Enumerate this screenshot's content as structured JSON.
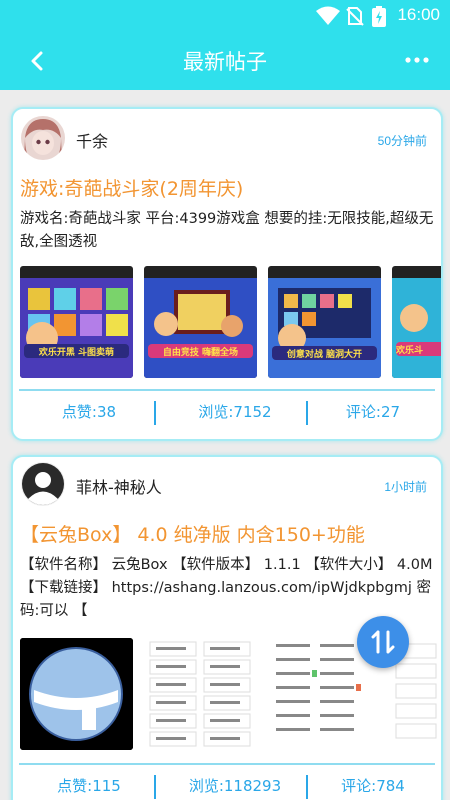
{
  "status_bar": {
    "time": "16:00"
  },
  "app_bar": {
    "title": "最新帖子"
  },
  "posts": [
    {
      "username": "千余",
      "time_ago": "50分钟前",
      "title": "游戏:奇葩战斗家(2周年庆)",
      "body": "游戏名:奇葩战斗家 平台:4399游戏盒 想要的挂:无限技能,超级无敌,全图透视",
      "thumbnail_captions": [
        "欢乐开黑 斗图卖萌",
        "自由竞技 嗨翻全场",
        "创意对战 脑洞大开",
        "欢乐斗"
      ],
      "stats": {
        "likes": "点赞:38",
        "views": "浏览:7152",
        "comments": "评论:27"
      }
    },
    {
      "username": "菲林-神秘人",
      "time_ago": "1小时前",
      "title": "【云兔Box】 4.0 纯净版 内含150+功能",
      "body": "【软件名称】 云兔Box 【软件版本】 1.1.1 【软件大小】 4.0M 【下载链接】 https://ashang.lanzous.com/ipWjdkpbgmj 密码:可以 【",
      "stats": {
        "likes": "点赞:115",
        "views": "浏览:118293",
        "comments": "评论:784"
      }
    }
  ],
  "colors": {
    "accent": "#2fe0ec",
    "title_orange": "#f29532",
    "link_blue": "#2aa7e8",
    "fab_blue": "#3d8fe8"
  }
}
